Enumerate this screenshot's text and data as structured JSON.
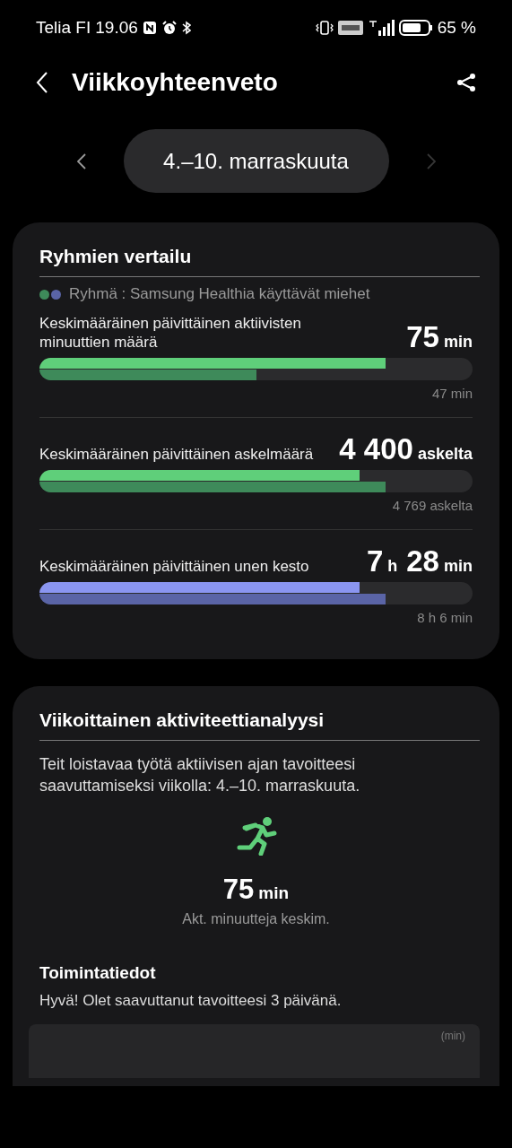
{
  "status_bar": {
    "carrier": "Telia FI",
    "time": "19.06",
    "battery": "65 %"
  },
  "header": {
    "title": "Viikkoyhteenveto"
  },
  "date_nav": {
    "label": "4.–10. marraskuuta",
    "prev_disabled": false,
    "next_disabled": true
  },
  "comparison": {
    "title": "Ryhmien vertailu",
    "group_label": "Ryhmä : Samsung Healthia käyttävät miehet",
    "legend": [
      {
        "color": "#3e8a5a"
      },
      {
        "color": "#5a64a6"
      }
    ],
    "metrics": [
      {
        "label": "Keskimääräinen päivittäinen aktiivisten minuuttien määrä",
        "value_parts": [
          {
            "number": "75",
            "unit": "min"
          }
        ],
        "kind": "activity",
        "level": 0.8,
        "group": {
          "level": 0.5,
          "reading": "47 min"
        }
      },
      {
        "label": "Keskimääräinen päivittäinen askelmäärä",
        "value_parts": [
          {
            "number": "4 400",
            "unit": "askelta"
          }
        ],
        "kind": "activity",
        "level": 0.74,
        "group": {
          "level": 0.8,
          "reading": "4 769 askelta"
        }
      },
      {
        "label": "Keskimääräinen päivittäinen unen kesto",
        "value_parts": [
          {
            "number": "7",
            "unit": "h"
          },
          {
            "number": "28",
            "unit": "min"
          }
        ],
        "kind": "sleep",
        "level": 0.74,
        "group": {
          "level": 0.8,
          "reading": "8 h  6 min"
        }
      }
    ]
  },
  "analysis": {
    "title": "Viikoittainen aktiviteettianalyysi",
    "text": "Teit loistavaa työtä aktiivisen ajan tavoitteesi saavuttamiseksi viikolla: 4.–10. marraskuuta.",
    "value": "75",
    "unit": "min",
    "caption": "Akt. minuutteja keskim.",
    "activity_title": "Toimintatiedot",
    "activity_text": "Hyvä! Olet saavuttanut tavoitteesi 3 päivänä.",
    "chart_unit": "(min)"
  }
}
